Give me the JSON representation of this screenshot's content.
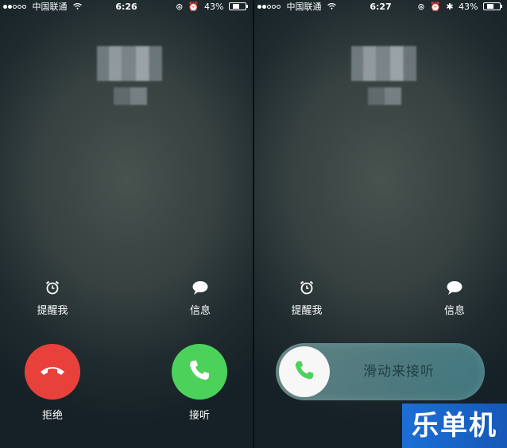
{
  "left": {
    "status": {
      "carrier": "中国联通",
      "time": "6:26",
      "battery": "43%",
      "battery_level_pct": 43
    },
    "options": {
      "remind": "提醒我",
      "message": "信息"
    },
    "buttons": {
      "decline": "拒绝",
      "accept": "接听"
    }
  },
  "right": {
    "status": {
      "carrier": "中国联通",
      "time": "6:27",
      "battery": "43%",
      "battery_level_pct": 43
    },
    "options": {
      "remind": "提醒我",
      "message": "信息"
    },
    "slider": {
      "label": "滑动来接听"
    }
  },
  "watermark": {
    "text": "乐单机"
  },
  "colors": {
    "decline": "#e8413c",
    "accept": "#4cd15b",
    "watermark_bg": "#1c6fd6"
  },
  "icons": {
    "wifi": "wifi-icon",
    "alarm": "alarm-clock-icon",
    "message": "speech-bubble-icon",
    "phone": "phone-handset-icon",
    "orientation_lock": "orientation-lock-icon",
    "bluetooth": "bluetooth-icon"
  }
}
